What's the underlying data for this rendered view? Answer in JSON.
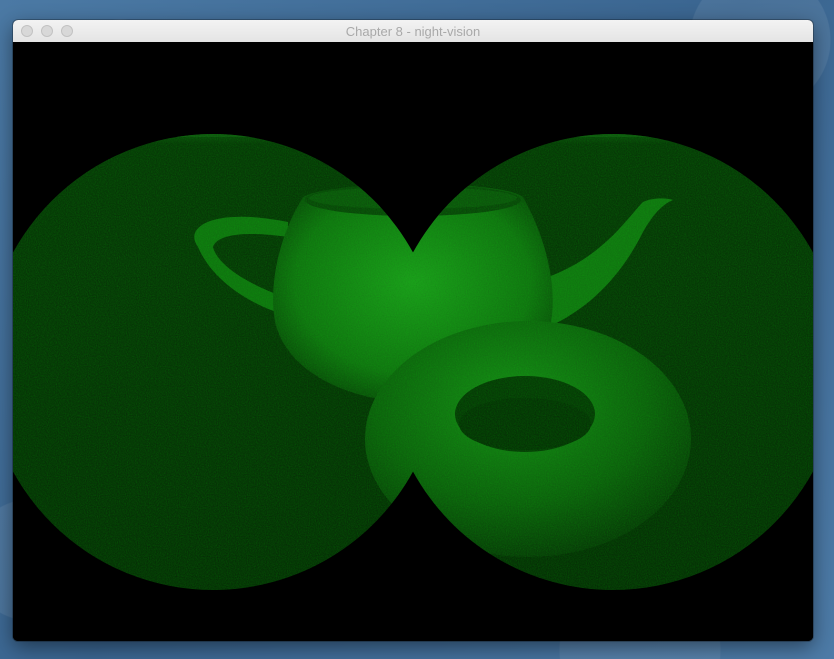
{
  "window": {
    "title": "Chapter 8 - night-vision"
  },
  "scene": {
    "effect": "night-vision",
    "objects": [
      "teapot",
      "torus"
    ],
    "colors": {
      "background": "#000000",
      "lens_fill": "#0b3a0b",
      "object_bright": "#1f9a1f",
      "object_dark": "#0a3a0a"
    }
  }
}
